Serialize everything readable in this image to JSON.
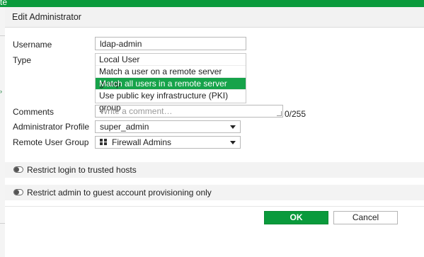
{
  "window": {
    "topbar_fragment": "te"
  },
  "dialog": {
    "title": "Edit Administrator",
    "username": {
      "label": "Username",
      "value": "ldap-admin"
    },
    "type": {
      "label": "Type",
      "options": [
        "Local User",
        "Match a user on a remote server group",
        "Match all users in a remote server group",
        "Use public key infrastructure (PKI) group"
      ],
      "selected": "Match all users in a remote server group"
    },
    "comments": {
      "label": "Comments",
      "placeholder": "Write a comment…",
      "counter": "0/255"
    },
    "admin_profile": {
      "label": "Administrator Profile",
      "value": "super_admin"
    },
    "remote_user_group": {
      "label": "Remote User Group",
      "value": "Firewall Admins",
      "icon": "group-grid-icon"
    },
    "restrict_trusted": {
      "label": "Restrict login to trusted hosts",
      "enabled": false
    },
    "restrict_guest": {
      "label": "Restrict admin to guest account provisioning only",
      "enabled": false
    },
    "buttons": {
      "ok": "OK",
      "cancel": "Cancel"
    }
  },
  "colors": {
    "accent": "#0a9a3c",
    "selected_option": "#16a34a"
  }
}
